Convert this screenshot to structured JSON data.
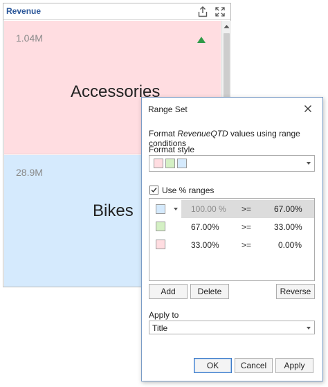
{
  "panel": {
    "title": "Revenue",
    "icons": {
      "export": "export-icon",
      "maximize": "maximize-icon",
      "scroll_up": "chevron-up-icon",
      "trend": "triangle-up-icon"
    },
    "tiles": [
      {
        "value": "1.04M",
        "title": "Accessories",
        "color": "#ffdde1",
        "trend": "up",
        "trend_color": "#2e9a47"
      },
      {
        "value": "28.9M",
        "title": "Bikes",
        "color": "#d5eafd"
      }
    ]
  },
  "dialog": {
    "title": "Range Set",
    "description": {
      "prefix": "Format ",
      "measure": "RevenueQTD",
      "suffix": " values using range conditions"
    },
    "format_style_label": "Format style",
    "format_style_swatches": [
      "#ffdde1",
      "#d4f0c4",
      "#d5eafd"
    ],
    "use_percent_ranges": {
      "label": "Use % ranges",
      "checked": true
    },
    "ranges": [
      {
        "color": "#d5eafd",
        "from": "100.00 %",
        "op": ">=",
        "to": "67.00%",
        "selected": true
      },
      {
        "color": "#d4f0c4",
        "from": "67.00%",
        "op": ">=",
        "to": "33.00%"
      },
      {
        "color": "#ffdde1",
        "from": "33.00%",
        "op": ">=",
        "to": "0.00%"
      }
    ],
    "buttons": {
      "add": "Add",
      "delete": "Delete",
      "reverse": "Reverse",
      "ok": "OK",
      "cancel": "Cancel",
      "apply": "Apply"
    },
    "apply_to_label": "Apply to",
    "apply_to_value": "Title",
    "icons": {
      "close": "close-icon",
      "dropdown": "chevron-down-icon",
      "check": "checkmark-icon"
    }
  }
}
